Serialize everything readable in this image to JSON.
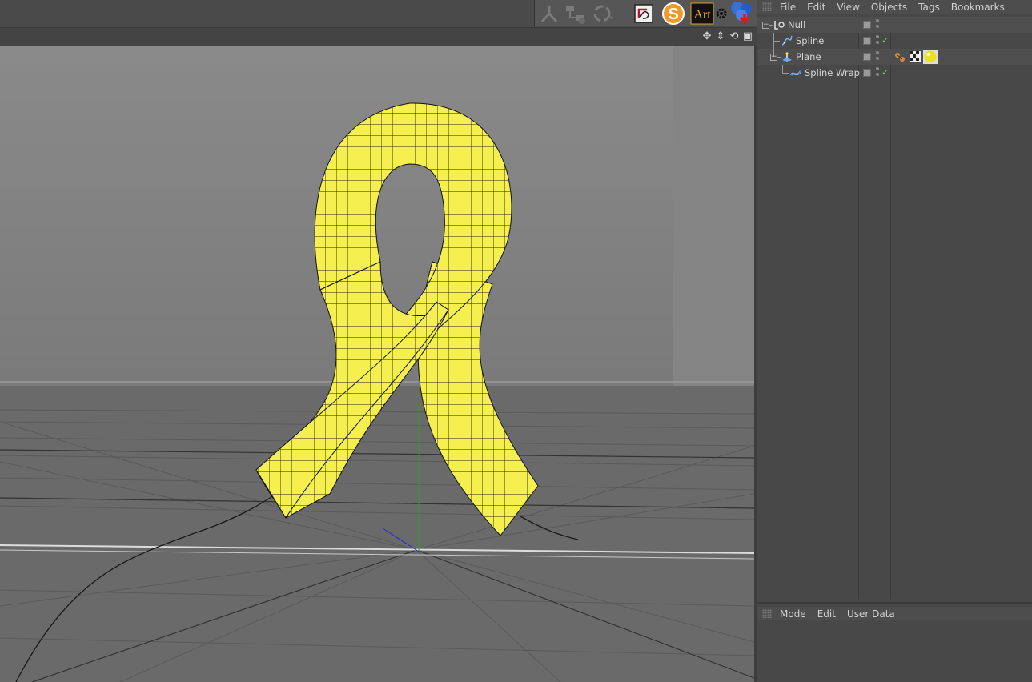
{
  "toolbar": {
    "icons": [
      "joint-icon",
      "hierarchy-icon",
      "recycle-icon",
      "render-region-icon",
      "sketch-s-icon",
      "art-icon",
      "gear-icon",
      "spheres-download-icon"
    ],
    "art_label": "Art",
    "s_label": "S"
  },
  "object_manager": {
    "menu": [
      "File",
      "Edit",
      "View",
      "Objects",
      "Tags",
      "Bookmarks"
    ],
    "objects": [
      {
        "name": "Null",
        "icon": "null-icon",
        "depth": 0,
        "check": false
      },
      {
        "name": "Spline",
        "icon": "spline-icon",
        "depth": 1,
        "check": true
      },
      {
        "name": "Plane",
        "icon": "plane-icon",
        "depth": 1,
        "check": false,
        "tags": [
          "uv-tag-icon",
          "texture-tag-icon",
          "material-tag-icon"
        ]
      },
      {
        "name": "Spline Wrap",
        "icon": "spline-wrap-icon",
        "depth": 2,
        "check": true
      }
    ]
  },
  "attribute_manager": {
    "menu": [
      "Mode",
      "Edit",
      "User Data"
    ]
  },
  "colors": {
    "ribbon": "#f5f050",
    "ribbon_wire": "#1a1a00",
    "viewport_bg": "#6e6e6e",
    "panel_bg": "#484848",
    "check": "#6fd25f"
  }
}
